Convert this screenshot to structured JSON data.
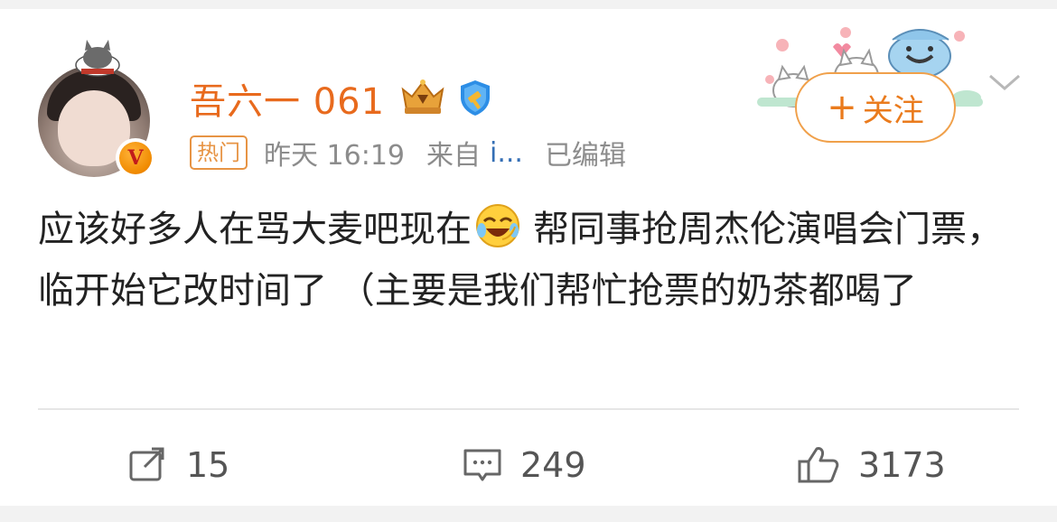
{
  "post": {
    "username": "吾六一 061",
    "hot_tag": "热门",
    "time": "昨天 16:19",
    "source_prefix": "来自",
    "source_name": "i...",
    "edited": "已编辑",
    "follow_label": "关注",
    "text_part1": "应该好多人在骂大麦吧现在",
    "text_part2": "帮同事抢周杰伦演唱会门票，临开始它改时间了 （主要是我们帮忙抢票的奶茶都喝了",
    "emoji": "laughing-crying-emoji"
  },
  "actions": {
    "repost_count": "15",
    "comment_count": "249",
    "like_count": "3173"
  },
  "colors": {
    "username": "#e86a1d",
    "follow": "#ea7b1d",
    "meta": "#8c8c8c",
    "source_link": "#356fb5",
    "text": "#222222"
  }
}
